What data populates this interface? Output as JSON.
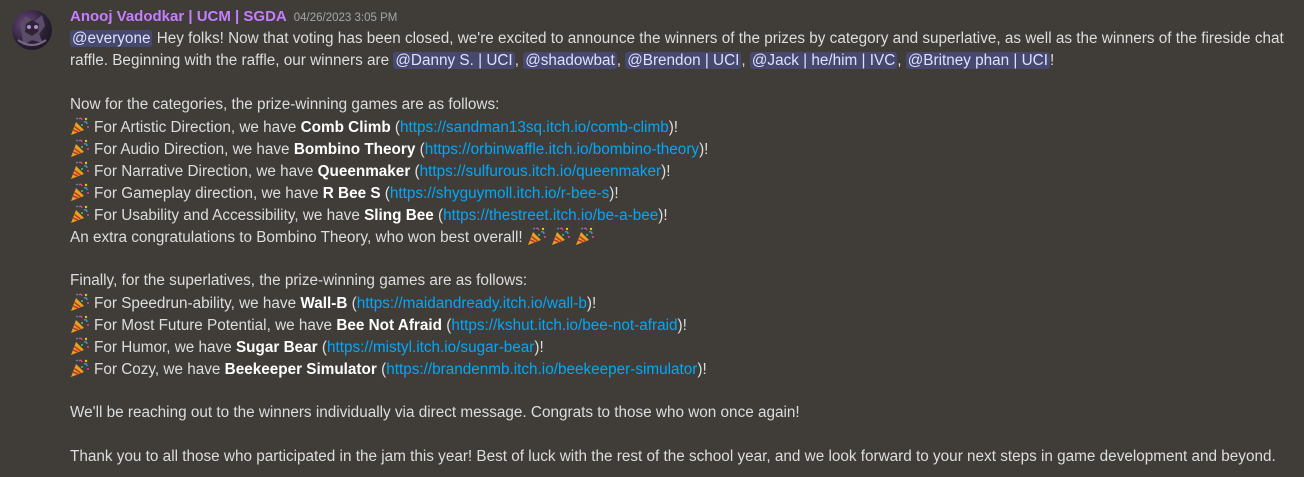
{
  "message": {
    "author": "Anooj Vadodkar | UCM | SGDA",
    "timestamp": "04/26/2023 3:05 PM",
    "intro": {
      "mention_everyone": "@everyone",
      "line1_text": " Hey folks! Now that voting has been closed, we're excited to announce the winners of the prizes by category and superlative, as well as the winners of the fireside chat",
      "line2_text": "raffle. Beginning with the raffle, our winners are ",
      "raffle_winners": [
        "@Danny S.  | UCI",
        "@shadowbat",
        "@Brendon | UCI",
        "@Jack | he/him | IVC",
        "@Britney phan | UCI"
      ],
      "separator": ", ",
      "end": "!"
    },
    "categories_heading": "Now for the categories, the prize-winning games are as follows:",
    "categories": [
      {
        "prefix": "For Artistic Direction, we have ",
        "game": "Comb Climb",
        "url": "https://sandman13sq.itch.io/comb-climb"
      },
      {
        "prefix": "For Audio Direction, we have ",
        "game": "Bombino Theory",
        "url": "https://orbinwaffle.itch.io/bombino-theory"
      },
      {
        "prefix": "For Narrative Direction, we have ",
        "game": "Queenmaker",
        "url": "https://sulfurous.itch.io/queenmaker"
      },
      {
        "prefix": "For Gameplay direction, we have ",
        "game": "R Bee S",
        "url": "https://shyguymoll.itch.io/r-bee-s"
      },
      {
        "prefix": "For Usability and Accessibility, we have ",
        "game": "Sling Bee",
        "url": "https://thestreet.itch.io/be-a-bee"
      }
    ],
    "best_overall": "An extra congratulations to Bombino Theory, who won best overall! ",
    "superlatives_heading": "Finally, for the superlatives, the prize-winning games are as follows:",
    "superlatives": [
      {
        "prefix": "For Speedrun-ability, we have ",
        "game": "Wall-B",
        "url": "https://maidandready.itch.io/wall-b"
      },
      {
        "prefix": "For Most Future Potential, we have ",
        "game": "Bee Not Afraid",
        "url": "https://kshut.itch.io/bee-not-afraid"
      },
      {
        "prefix": "For Humor, we have ",
        "game": "Sugar Bear",
        "url": "https://mistyl.itch.io/sugar-bear"
      },
      {
        "prefix": "For Cozy, we have ",
        "game": "Beekeeper Simulator",
        "url": "https://brandenmb.itch.io/beekeeper-simulator"
      }
    ],
    "outreach": "We'll be reaching out to the winners individually via direct message. Congrats to those who won once again!",
    "closing": "Thank you to all those who participated in the jam this year! Best of luck with the rest of the school year, and we look forward to your next steps in game development and beyond.",
    "emoji": "party-popper-icon",
    "colors": {
      "background": "#403d38",
      "username": "#c77dff",
      "link": "#00a8fc",
      "mention_bg": "#5865f2"
    }
  }
}
